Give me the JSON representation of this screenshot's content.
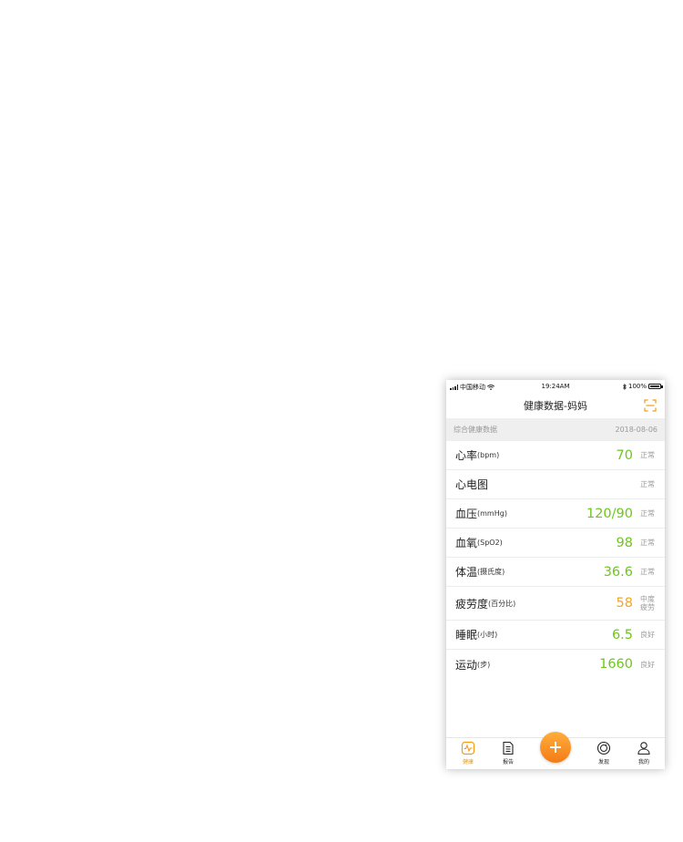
{
  "status_bar": {
    "carrier": "中国移动",
    "time": "19:24AM",
    "battery": "100%"
  },
  "navbar": {
    "title": "健康数据-妈妈",
    "scan_icon": "scan-icon",
    "accent": "#f39c12"
  },
  "section": {
    "label": "综合健康数据",
    "date": "2018-08-06"
  },
  "metrics": [
    {
      "name": "心率",
      "unit": "(bpm)",
      "value": "70",
      "status": "正常",
      "color": "#6ec51f"
    },
    {
      "name": "心电图",
      "unit": "",
      "value": "",
      "status": "正常",
      "color": "#6ec51f"
    },
    {
      "name": "血压",
      "unit": "(mmHg)",
      "value": "120/90",
      "status": "正常",
      "color": "#6ec51f"
    },
    {
      "name": "血氧",
      "unit": "(SpO2)",
      "value": "98",
      "status": "正常",
      "color": "#6ec51f"
    },
    {
      "name": "体温",
      "unit": "(摄氏度)",
      "value": "36.6",
      "status": "正常",
      "color": "#6ec51f"
    },
    {
      "name": "疲劳度",
      "unit": "(百分比)",
      "value": "58",
      "status": "中度疲劳",
      "status_line1": "中度",
      "status_line2": "疲劳",
      "color": "#f5a623"
    },
    {
      "name": "睡眠",
      "unit": "(小时)",
      "value": "6.5",
      "status": "良好",
      "color": "#6ec51f"
    },
    {
      "name": "运动",
      "unit": "(步)",
      "value": "1660",
      "status": "良好",
      "color": "#6ec51f"
    }
  ],
  "tabbar": {
    "tabs": [
      {
        "label": "健康",
        "icon": "heartbeat-icon",
        "active": true
      },
      {
        "label": "报告",
        "icon": "document-icon",
        "active": false
      },
      {
        "label": "",
        "icon": "plus-icon",
        "active": false
      },
      {
        "label": "发现",
        "icon": "compass-icon",
        "active": false
      },
      {
        "label": "我的",
        "icon": "user-icon",
        "active": false
      }
    ]
  }
}
